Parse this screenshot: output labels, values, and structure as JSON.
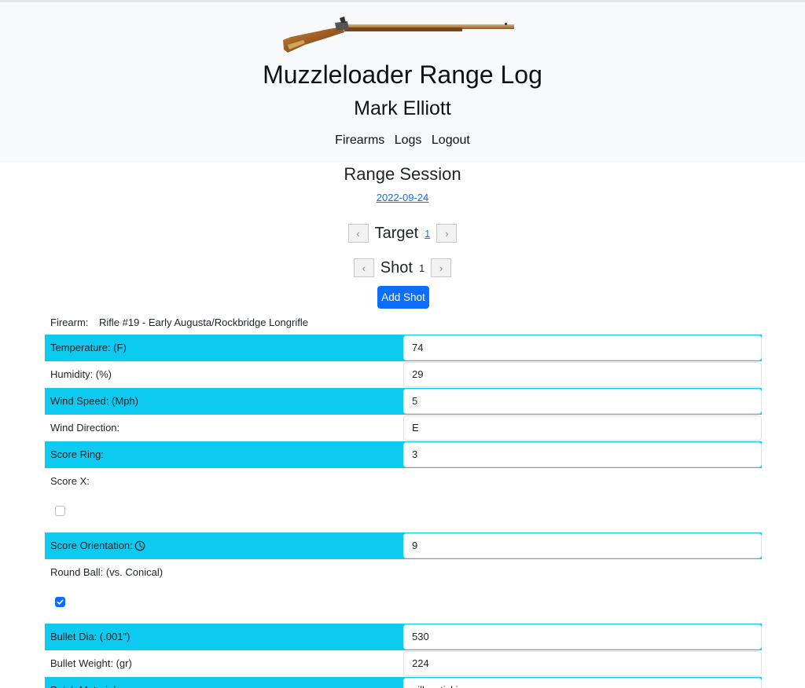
{
  "header": {
    "title": "Muzzleloader Range Log",
    "user_name": "Mark Elliott",
    "nav": [
      "Firearms",
      "Logs",
      "Logout"
    ],
    "colors": {
      "background": "#f8f9fa",
      "text": "#111111"
    }
  },
  "session": {
    "title": "Range Session",
    "date": "2022-09-24",
    "target_label": "Target",
    "target_number": "1",
    "shot_label": "Shot",
    "shot_number": "1",
    "prev_glyph": "‹",
    "next_glyph": "›",
    "add_shot_label": "Add Shot"
  },
  "firearm": {
    "label": "Firearm:",
    "value": "Rifle #19 - Early Augusta/Rockbridge Longrifle"
  },
  "fields": {
    "temperature": {
      "label": "Temperature: (F)",
      "value": "74"
    },
    "humidity": {
      "label": "Humidity: (%)",
      "value": "29"
    },
    "wind_speed": {
      "label": "Wind Speed: (Mph)",
      "value": "5"
    },
    "wind_direction": {
      "label": "Wind Direction:",
      "value": "E"
    },
    "score_ring": {
      "label": "Score Ring:",
      "value": "3"
    },
    "score_x": {
      "label": "Score X:",
      "checked": false
    },
    "score_orientation": {
      "label": "Score Orientation:",
      "icon": "clock-icon",
      "value": "9"
    },
    "round_ball": {
      "label": "Round Ball: (vs. Conical)",
      "checked": true
    },
    "bullet_dia": {
      "label": "Bullet Dia: (.001\")",
      "value": "530"
    },
    "bullet_weight": {
      "label": "Bullet Weight: (gr)",
      "value": "224"
    },
    "patch_material": {
      "label": "Patch Material:",
      "value": "pillow ticking"
    }
  },
  "colors": {
    "highlight_row": "#0dcaf0",
    "primary": "#0d6efd",
    "link": "#0d6efd"
  }
}
